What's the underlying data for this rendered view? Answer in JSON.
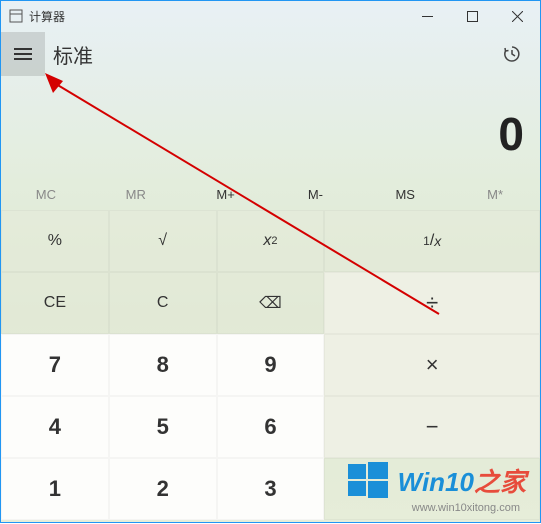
{
  "titlebar": {
    "title": "计算器"
  },
  "header": {
    "mode": "标准"
  },
  "display": {
    "value": "0"
  },
  "memory": {
    "mc": "MC",
    "mr": "MR",
    "mplus": "M+",
    "mminus": "M-",
    "ms": "MS",
    "mlist": "M*"
  },
  "buttons": {
    "percent": "%",
    "sqrt": "√",
    "square": "x",
    "square_sup": "2",
    "reciprocal_num": "1",
    "reciprocal_den": "x",
    "ce": "CE",
    "c": "C",
    "backspace": "⌫",
    "divide": "÷",
    "n7": "7",
    "n8": "8",
    "n9": "9",
    "multiply": "×",
    "n4": "4",
    "n5": "5",
    "n6": "6",
    "minus": "−",
    "n1": "1",
    "n2": "2",
    "n3": "3"
  },
  "watermark": {
    "brand": "Win10",
    "suffix": "之家",
    "url": "www.win10xitong.com"
  }
}
